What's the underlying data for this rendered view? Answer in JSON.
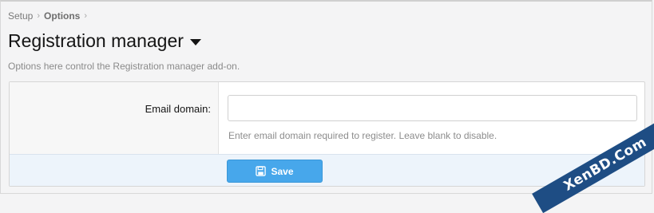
{
  "breadcrumb": {
    "items": [
      "Setup",
      "Options"
    ],
    "separator": "›"
  },
  "page": {
    "title": "Registration manager",
    "description": "Options here control the Registration manager add-on."
  },
  "form": {
    "email_domain": {
      "label": "Email domain:",
      "value": "",
      "hint": "Enter email domain required to register. Leave blank to disable."
    },
    "save_label": "Save"
  },
  "watermark": "XenBD.Com",
  "colors": {
    "accent": "#47a7eb",
    "footer_bg": "#edf4fb",
    "watermark_bg": "#1e4d84"
  },
  "icons": {
    "title_menu": "caret-down-icon",
    "save": "floppy-disk-icon"
  }
}
